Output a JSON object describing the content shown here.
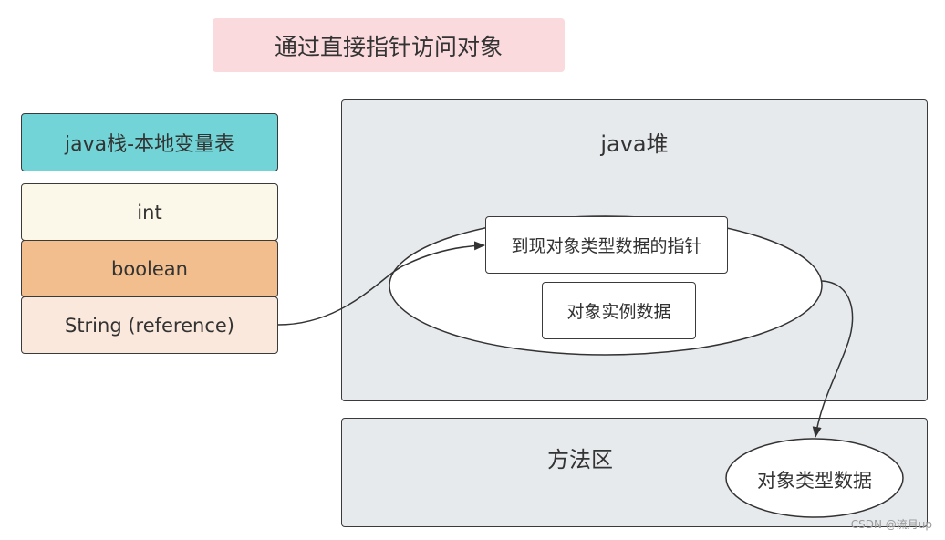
{
  "title": "通过直接指针访问对象",
  "stack": {
    "header": "java栈-本地变量表",
    "cells": [
      "int",
      "boolean",
      "String (reference)"
    ]
  },
  "heap": {
    "label": "java堆",
    "object": {
      "pointer_box": "到现对象类型数据的指针",
      "instance_box": "对象实例数据"
    }
  },
  "method_area": {
    "label": "方法区",
    "type_data": "对象类型数据"
  },
  "colors": {
    "title_bg": "#fadadd",
    "stack_header_bg": "#72d4d6",
    "int_bg": "#fbf7e9",
    "boolean_bg": "#f2be8e",
    "string_bg": "#fbe8dc",
    "region_bg": "#e7eaed"
  },
  "watermark": "CSDN @流月up"
}
